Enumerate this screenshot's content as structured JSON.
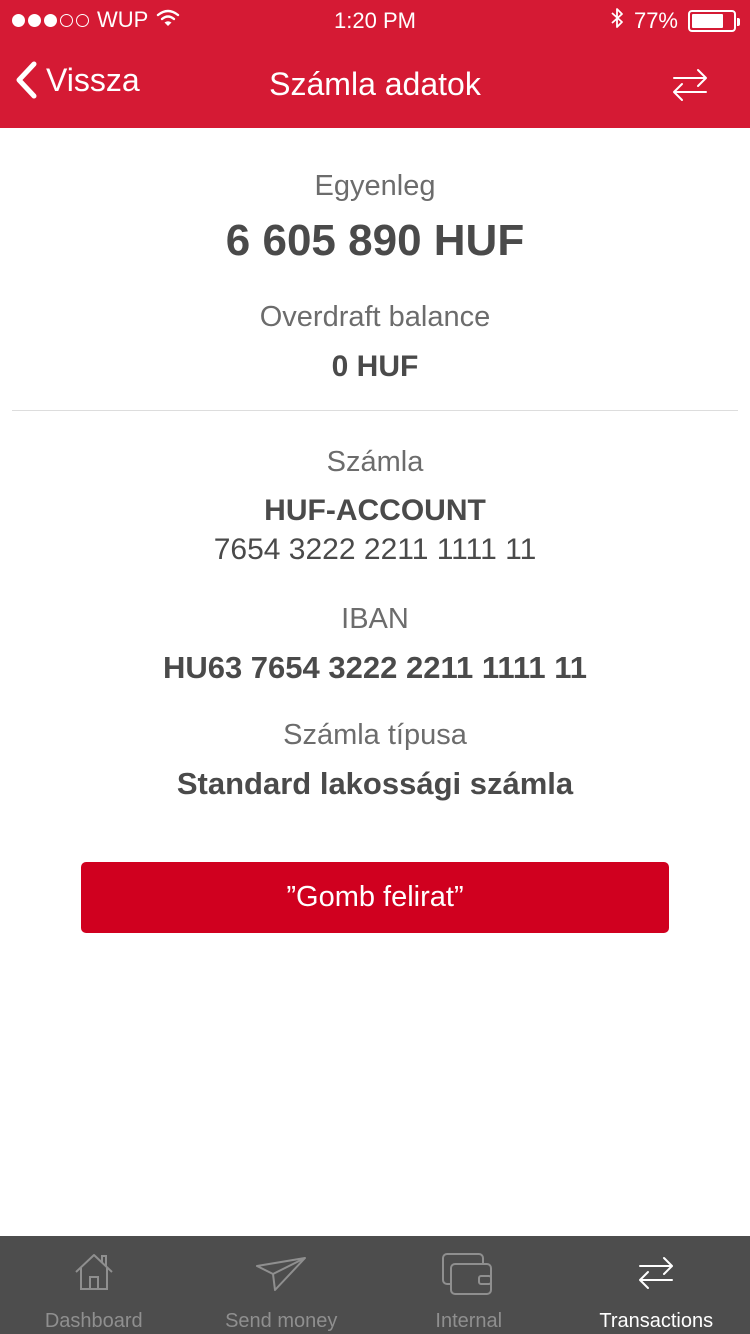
{
  "status_bar": {
    "carrier": "WUP",
    "time": "1:20 PM",
    "battery_text": "77%",
    "battery_level": 0.77,
    "signal_icon": "signal-dots-icon",
    "wifi_icon": "wifi-icon",
    "bluetooth_icon": "bluetooth-icon"
  },
  "nav": {
    "back_label": "Vissza",
    "title": "Számla adatok",
    "action_icon": "transfer-arrows-icon"
  },
  "balance": {
    "label": "Egyenleg",
    "value": "6 605 890 HUF"
  },
  "overdraft": {
    "label": "Overdraft balance",
    "value": "0 HUF"
  },
  "account": {
    "label": "Számla",
    "name": "HUF-ACCOUNT",
    "number": "7654 3222 2211 1111 11"
  },
  "iban": {
    "label": "IBAN",
    "value": "HU63 7654 3222 2211 1111 11"
  },
  "account_type": {
    "label": "Számla típusa",
    "value": "Standard lakossági számla"
  },
  "button": {
    "label": "”Gomb felirat”"
  },
  "tabbar": {
    "items": [
      {
        "label": "Dashboard",
        "icon": "home-icon",
        "active": false
      },
      {
        "label": "Send money",
        "icon": "paper-plane-icon",
        "active": false
      },
      {
        "label": "Internal",
        "icon": "wallet-icon",
        "active": false
      },
      {
        "label": "Transactions",
        "icon": "transfer-arrows-icon",
        "active": true
      }
    ]
  },
  "colors": {
    "header_red": "#d51a34",
    "button_red": "#d0001f",
    "tabbar_bg": "#4d4d4d"
  }
}
